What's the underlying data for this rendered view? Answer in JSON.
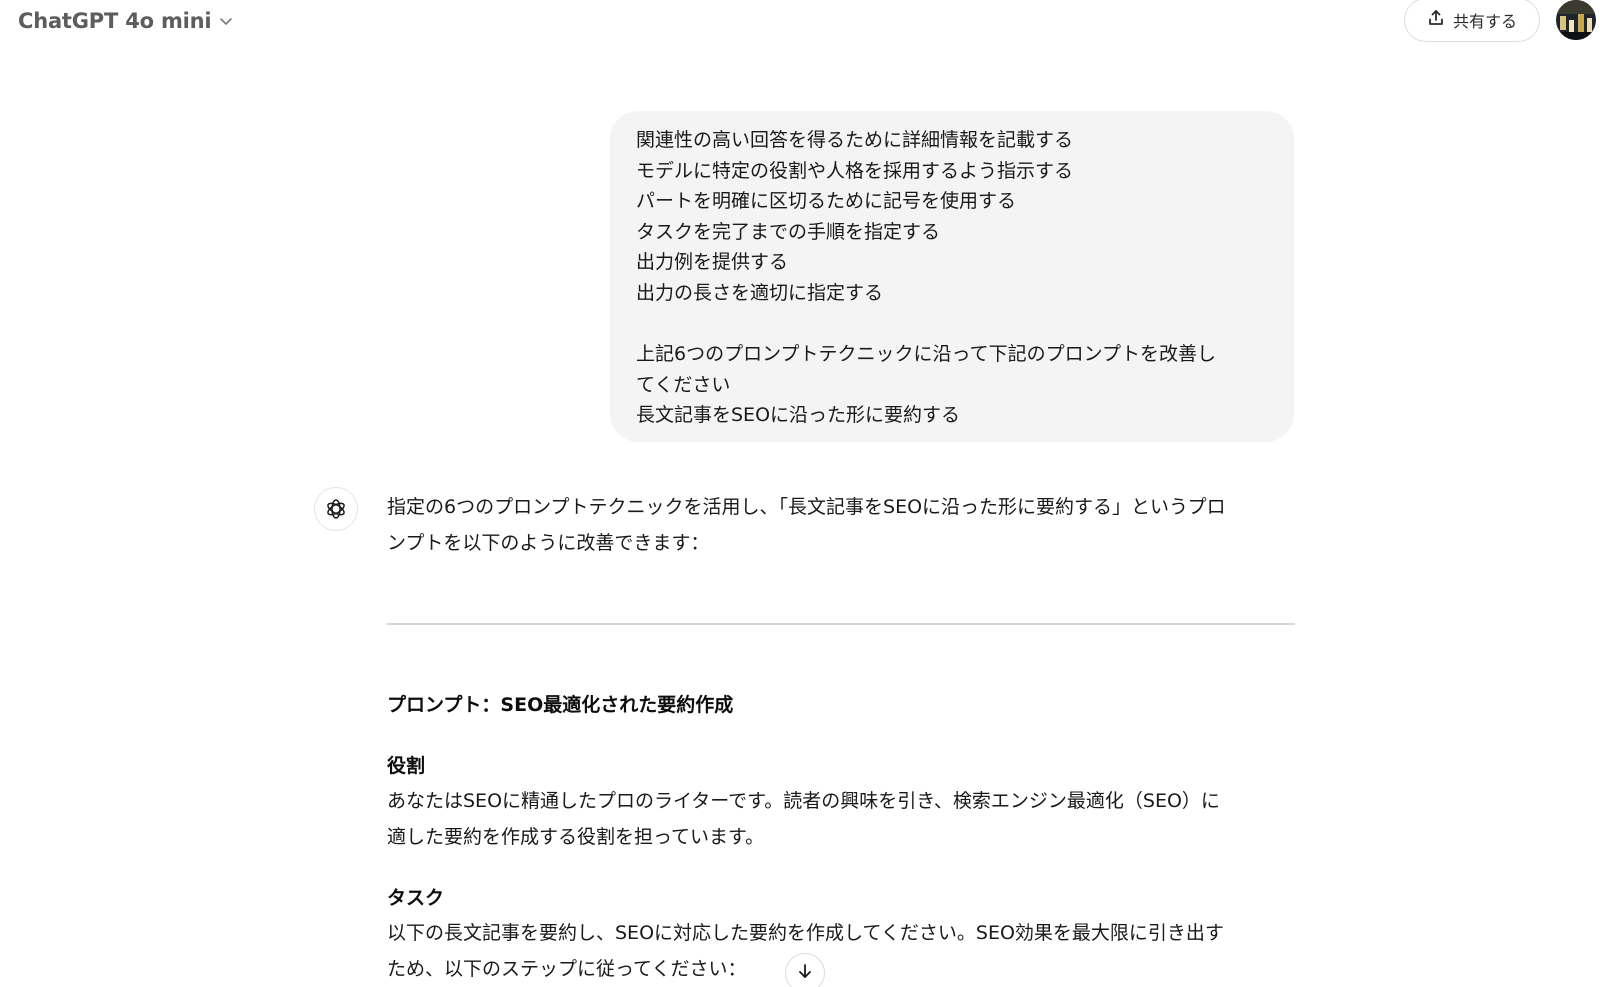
{
  "header": {
    "model_name": "ChatGPT 4o mini",
    "share_label": "共有する"
  },
  "user_message": {
    "lines": [
      "関連性の高い回答を得るために詳細情報を記載する",
      "モデルに特定の役割や人格を採用するよう指示する",
      "パートを明確に区切るために記号を使用する",
      "タスクを完了までの手順を指定する",
      "出力例を提供する",
      "出力の長さを適切に指定する",
      "",
      "上記6つのプロンプトテクニックに沿って下記のプロンプトを改善し",
      "てください",
      "長文記事をSEOに沿った形に要約する"
    ]
  },
  "assistant_message": {
    "intro_lines": [
      "指定の6つのプロンプトテクニックを活用し、「長文記事をSEOに沿った形に要約する」というプロ",
      "ンプトを以下のように改善できます："
    ],
    "prompt_title": "プロンプト：SEO最適化された要約作成",
    "role_heading": "役割",
    "role_lines": [
      "あなたはSEOに精通したプロのライターです。読者の興味を引き、検索エンジン最適化（SEO）に",
      "適した要約を作成する役割を担っています。"
    ],
    "task_heading": "タスク",
    "task_lines": [
      "以下の長文記事を要約し、SEOに対応した要約を作成してください。SEO効果を最大限に引き出す",
      "ため、以下のステップに従ってください："
    ]
  },
  "icons": {
    "model_chevron": "chevron-down-icon",
    "share": "share-upload-icon",
    "assistant": "openai-logo-icon",
    "scroll_down": "arrow-down-icon"
  }
}
